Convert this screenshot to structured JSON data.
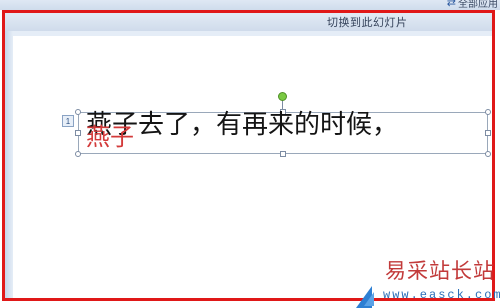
{
  "toolbar": {
    "top_right_label": "全部应用"
  },
  "slide_header": {
    "label": "切换到此幻灯片"
  },
  "slide": {
    "animation_order": "1",
    "main_text": "燕子去了，有再来的时候，",
    "overlay_text": "燕子"
  },
  "watermark": {
    "title": "易采站长站",
    "url": "www.easck.com"
  },
  "colors": {
    "highlight_frame": "#e01818",
    "overlay_text": "#d33a3a",
    "rotate_handle": "#7ac943"
  }
}
